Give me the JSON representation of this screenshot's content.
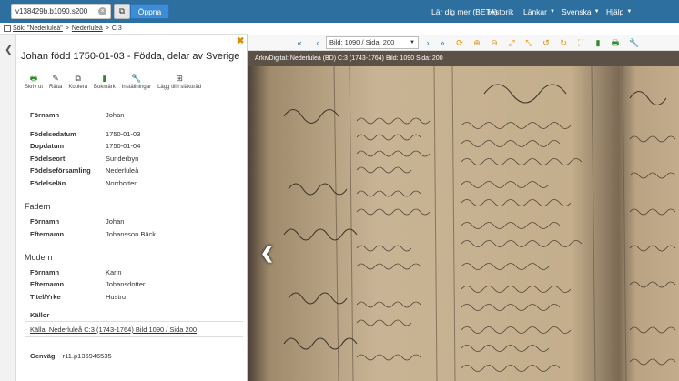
{
  "topbar": {
    "search_value": "v138429b.b1090.s200",
    "clear_icon": "clear-icon",
    "copy_icon": "copy-icon",
    "open_label": "Öppna",
    "nav": [
      {
        "label": "Lär dig mer (BETA)",
        "dropdown": false
      },
      {
        "label": "Historik",
        "dropdown": false
      },
      {
        "label": "Länkar",
        "dropdown": true
      },
      {
        "label": "Svenska",
        "dropdown": true
      },
      {
        "label": "Hjälp",
        "dropdown": true
      }
    ],
    "bg_color": "#2d6f9e"
  },
  "breadcrumb": {
    "search_link": "Sök: \"Nederluleå\"",
    "sep1": ">",
    "place_link": "Nederluleå",
    "sep2": ">",
    "volume": "C:3"
  },
  "record": {
    "title": "Johan född 1750-01-03 - Födda, delar av Sverige",
    "tools": [
      {
        "icon": "print-icon",
        "label": "Skriv ut",
        "glyph": "🖶",
        "color": "#2e8b2e"
      },
      {
        "icon": "pencil-icon",
        "label": "Rätta",
        "glyph": "✎",
        "color": "#333"
      },
      {
        "icon": "copy-icon",
        "label": "Kopiera",
        "glyph": "⧉",
        "color": "#333"
      },
      {
        "icon": "bookmark-icon",
        "label": "Bokmärk",
        "glyph": "▮",
        "color": "#2e8b2e"
      },
      {
        "icon": "wrench-icon",
        "label": "Inställningar",
        "glyph": "🔧",
        "color": "#333"
      },
      {
        "icon": "family-tree-icon",
        "label": "Lägg till i släktträd",
        "glyph": "⊞",
        "color": "#333"
      }
    ],
    "person": {
      "fornamn_label": "Förnamn",
      "fornamn": "Johan",
      "fodelsedatum_label": "Födelsedatum",
      "fodelsedatum": "1750-01-03",
      "dopdatum_label": "Dopdatum",
      "dopdatum": "1750-01-04",
      "fodelseort_label": "Födelseort",
      "fodelseort": "Sunderbyn",
      "forsamling_label": "Födelseförsamling",
      "forsamling": "Nederluleå",
      "lan_label": "Födelselän",
      "lan": "Norrbotten"
    },
    "father": {
      "heading": "Fadern",
      "fornamn_label": "Förnamn",
      "fornamn": "Johan",
      "efternamn_label": "Efternamn",
      "efternamn": "Johansson Bäck"
    },
    "mother": {
      "heading": "Modern",
      "fornamn_label": "Förnamn",
      "fornamn": "Karin",
      "efternamn_label": "Efternamn",
      "efternamn": "Johansdotter",
      "titel_label": "Titel/Yrke",
      "titel": "Hustru"
    },
    "sources_heading": "Källor",
    "source_link": "Källa: Nederluleå C:3 (1743-1764) Bild 1090 / Sida 200",
    "genvag_label": "Genväg",
    "genvag_value": "r11.p136946535"
  },
  "viewer": {
    "toolbar_icons": [
      {
        "name": "first-page-icon",
        "glyph": "⏮",
        "color": "#2d6fb7"
      },
      {
        "name": "prev-page-icon",
        "glyph": "◀",
        "color": "#2d6fb7"
      },
      {
        "name": "next-page-icon",
        "glyph": "▶",
        "color": "#2d6fb7"
      },
      {
        "name": "last-page-icon",
        "glyph": "⏭",
        "color": "#2d6fb7"
      },
      {
        "name": "refresh-icon",
        "glyph": "⟳",
        "color": "#e08a00"
      },
      {
        "name": "zoom-in-icon",
        "glyph": "⊕",
        "color": "#e08a00"
      },
      {
        "name": "zoom-out-icon",
        "glyph": "⊖",
        "color": "#e08a00"
      },
      {
        "name": "fit-icon",
        "glyph": "⤢",
        "color": "#e08a00"
      },
      {
        "name": "fit-height-icon",
        "glyph": "⤡",
        "color": "#e08a00"
      },
      {
        "name": "rotate-left-icon",
        "glyph": "↺",
        "color": "#e08a00"
      },
      {
        "name": "rotate-right-icon",
        "glyph": "↻",
        "color": "#e08a00"
      },
      {
        "name": "fullscreen-icon",
        "glyph": "⛶",
        "color": "#e08a00"
      },
      {
        "name": "bookmark-icon",
        "glyph": "▮",
        "color": "#2e8b2e"
      },
      {
        "name": "print-icon",
        "glyph": "🖶",
        "color": "#2e8b2e"
      },
      {
        "name": "wrench-icon",
        "glyph": "🔧",
        "color": "#333"
      }
    ],
    "page_select": "Bild: 1090 / Sida: 200",
    "image_caption": "ArkivDigital: Nederluleå (BD) C:3 (1743-1764) Bild: 1090 Sida: 200",
    "collapse_icon": "chevron-left-icon",
    "prev_image_icon": "chevron-left-icon"
  }
}
